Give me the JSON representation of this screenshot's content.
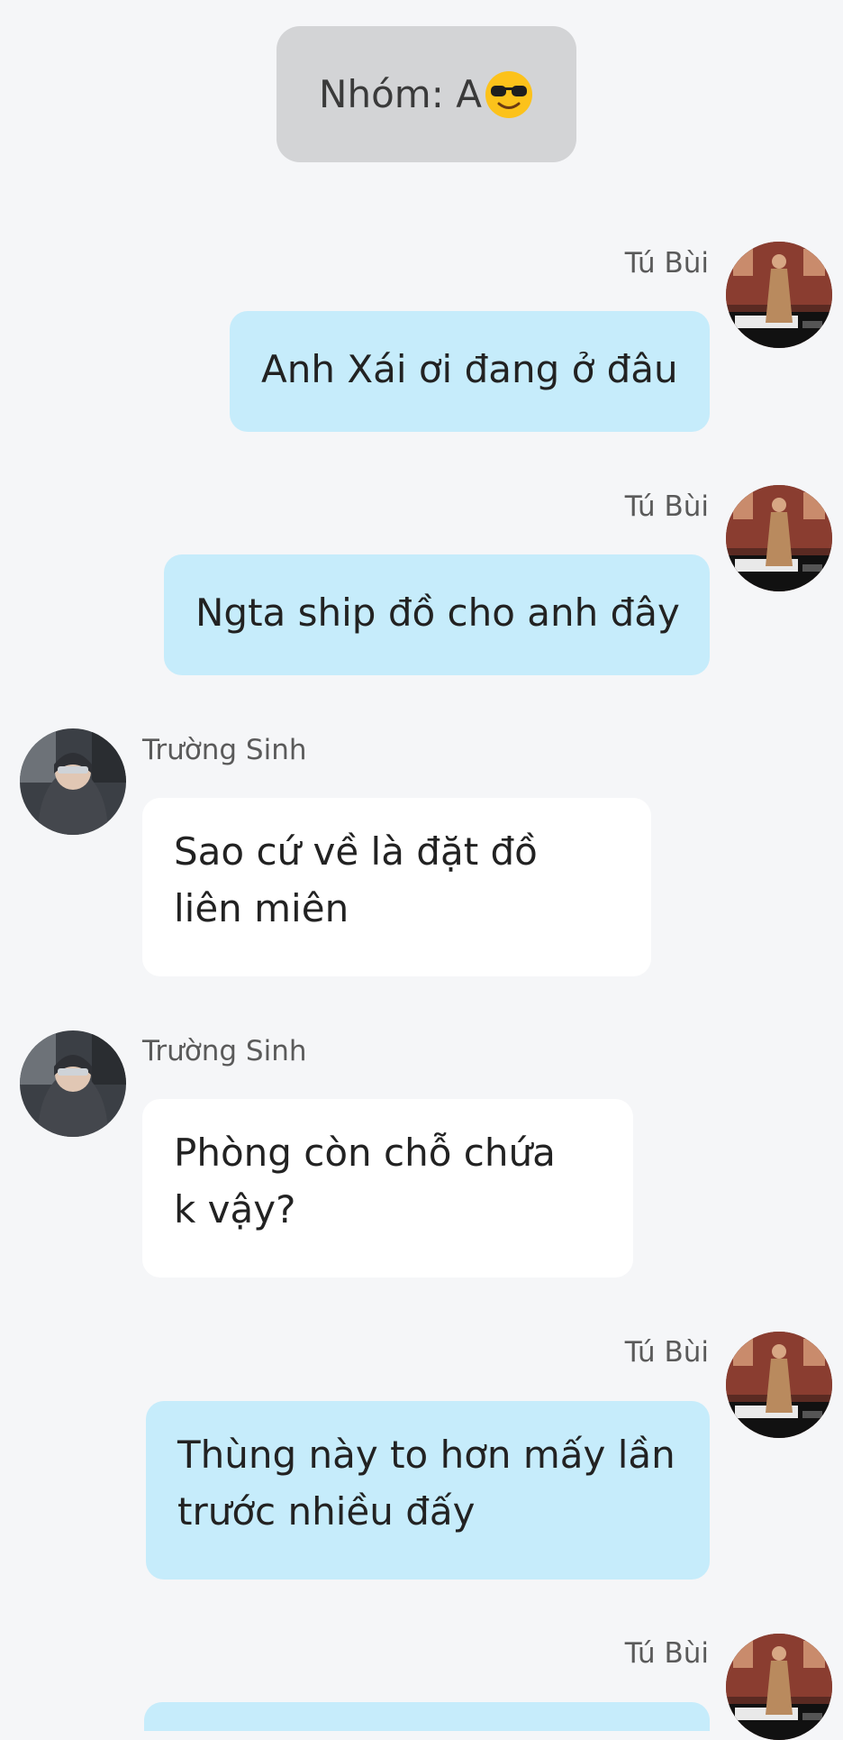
{
  "group_header": {
    "label": "Nhóm: A",
    "emoji_icon": "sunglasses-face-icon"
  },
  "messages": [
    {
      "sender": "Tú Bùi",
      "direction": "outgoing",
      "lines": [
        "Anh Xái ơi đang ở đâu"
      ]
    },
    {
      "sender": "Tú Bùi",
      "direction": "outgoing",
      "lines": [
        "Ngta ship đồ cho anh đây"
      ]
    },
    {
      "sender": "Trường Sinh",
      "direction": "incoming",
      "lines": [
        "Sao cứ về là đặt đồ",
        "liên miên"
      ]
    },
    {
      "sender": "Trường Sinh",
      "direction": "incoming",
      "lines": [
        "Phòng còn chỗ chứa",
        "k vậy?"
      ]
    },
    {
      "sender": "Tú Bùi",
      "direction": "outgoing",
      "lines": [
        "Thùng này to hơn mấy lần",
        "trước nhiều đấy"
      ]
    },
    {
      "sender": "Tú Bùi",
      "direction": "outgoing",
      "lines": []
    }
  ],
  "colors": {
    "background": "#f5f6f8",
    "outgoing_bubble": "#c6ecfb",
    "incoming_bubble": "#ffffff",
    "group_pill": "#d3d4d6"
  }
}
